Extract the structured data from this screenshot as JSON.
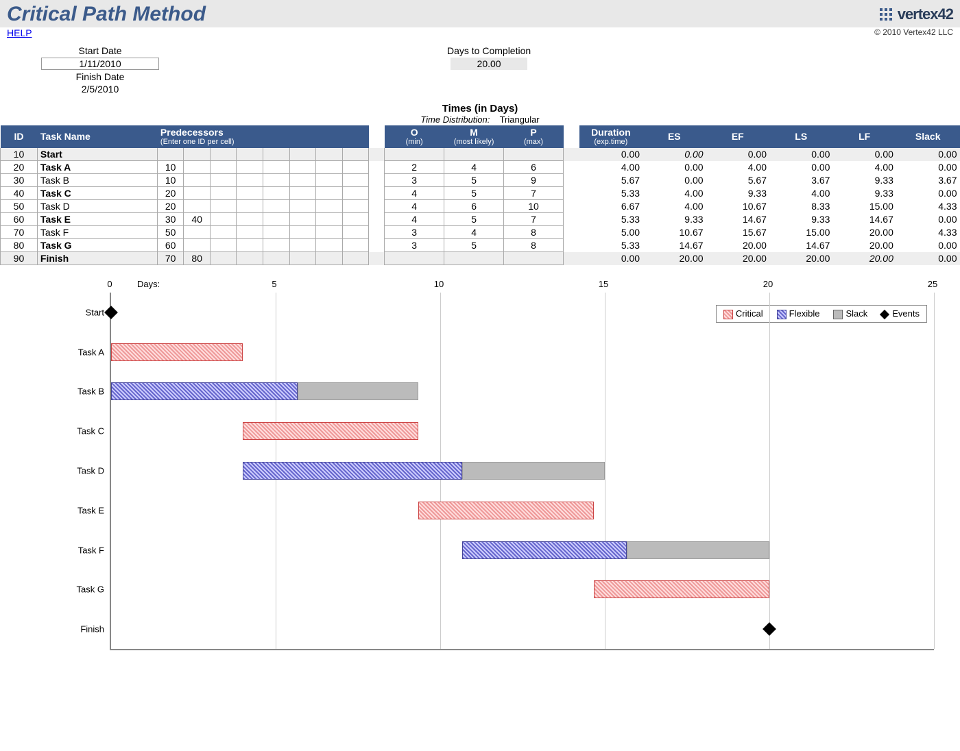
{
  "header": {
    "title": "Critical Path Method",
    "help_link": "HELP",
    "brand": "vertex42",
    "copyright": "© 2010 Vertex42 LLC"
  },
  "summary": {
    "start_date_label": "Start Date",
    "start_date_value": "1/11/2010",
    "finish_date_label": "Finish Date",
    "finish_date_value": "2/5/2010",
    "days_to_completion_label": "Days to Completion",
    "days_to_completion_value": "20.00"
  },
  "table_headers": {
    "times_heading": "Times (in Days)",
    "time_distribution_label": "Time Distribution:",
    "time_distribution_value": "Triangular",
    "id": "ID",
    "task_name": "Task Name",
    "predecessors": "Predecessors",
    "predecessors_sub": "(Enter one ID per cell)",
    "o": "O",
    "o_sub": "(min)",
    "m": "M",
    "m_sub": "(most likely)",
    "p": "P",
    "p_sub": "(max)",
    "duration": "Duration",
    "duration_sub": "(exp.time)",
    "es": "ES",
    "ef": "EF",
    "ls": "LS",
    "lf": "LF",
    "slack": "Slack"
  },
  "tasks": [
    {
      "id": "10",
      "name": "Start",
      "bold": true,
      "shade": true,
      "pred": [
        "",
        "",
        "",
        "",
        "",
        "",
        "",
        ""
      ],
      "o": "",
      "m": "",
      "p": "",
      "dur": "0.00",
      "es": "0.00",
      "es_italic": true,
      "ef": "0.00",
      "ls": "0.00",
      "lf": "0.00",
      "slack": "0.00"
    },
    {
      "id": "20",
      "name": "Task A",
      "bold": true,
      "shade": false,
      "pred": [
        "10",
        "",
        "",
        "",
        "",
        "",
        "",
        ""
      ],
      "o": "2",
      "m": "4",
      "p": "6",
      "dur": "4.00",
      "es": "0.00",
      "ef": "4.00",
      "ls": "0.00",
      "lf": "4.00",
      "slack": "0.00"
    },
    {
      "id": "30",
      "name": "Task B",
      "bold": false,
      "shade": false,
      "pred": [
        "10",
        "",
        "",
        "",
        "",
        "",
        "",
        ""
      ],
      "o": "3",
      "m": "5",
      "p": "9",
      "dur": "5.67",
      "es": "0.00",
      "ef": "5.67",
      "ls": "3.67",
      "lf": "9.33",
      "slack": "3.67"
    },
    {
      "id": "40",
      "name": "Task C",
      "bold": true,
      "shade": false,
      "pred": [
        "20",
        "",
        "",
        "",
        "",
        "",
        "",
        ""
      ],
      "o": "4",
      "m": "5",
      "p": "7",
      "dur": "5.33",
      "es": "4.00",
      "ef": "9.33",
      "ls": "4.00",
      "lf": "9.33",
      "slack": "0.00"
    },
    {
      "id": "50",
      "name": "Task D",
      "bold": false,
      "shade": false,
      "pred": [
        "20",
        "",
        "",
        "",
        "",
        "",
        "",
        ""
      ],
      "o": "4",
      "m": "6",
      "p": "10",
      "dur": "6.67",
      "es": "4.00",
      "ef": "10.67",
      "ls": "8.33",
      "lf": "15.00",
      "slack": "4.33"
    },
    {
      "id": "60",
      "name": "Task E",
      "bold": true,
      "shade": false,
      "pred": [
        "30",
        "40",
        "",
        "",
        "",
        "",
        "",
        ""
      ],
      "o": "4",
      "m": "5",
      "p": "7",
      "dur": "5.33",
      "es": "9.33",
      "ef": "14.67",
      "ls": "9.33",
      "lf": "14.67",
      "slack": "0.00"
    },
    {
      "id": "70",
      "name": "Task F",
      "bold": false,
      "shade": false,
      "pred": [
        "50",
        "",
        "",
        "",
        "",
        "",
        "",
        ""
      ],
      "o": "3",
      "m": "4",
      "p": "8",
      "dur": "5.00",
      "es": "10.67",
      "ef": "15.67",
      "ls": "15.00",
      "lf": "20.00",
      "slack": "4.33"
    },
    {
      "id": "80",
      "name": "Task G",
      "bold": true,
      "shade": false,
      "pred": [
        "60",
        "",
        "",
        "",
        "",
        "",
        "",
        ""
      ],
      "o": "3",
      "m": "5",
      "p": "8",
      "dur": "5.33",
      "es": "14.67",
      "ef": "20.00",
      "ls": "14.67",
      "lf": "20.00",
      "slack": "0.00"
    },
    {
      "id": "90",
      "name": "Finish",
      "bold": true,
      "shade": true,
      "pred": [
        "70",
        "80",
        "",
        "",
        "",
        "",
        "",
        ""
      ],
      "o": "",
      "m": "",
      "p": "",
      "dur": "0.00",
      "es": "20.00",
      "ef": "20.00",
      "ls": "20.00",
      "lf": "20.00",
      "lf_italic": true,
      "slack": "0.00"
    }
  ],
  "chart": {
    "days_label": "Days:",
    "legend": {
      "critical": "Critical",
      "flexible": "Flexible",
      "slack": "Slack",
      "events": "Events"
    }
  },
  "chart_data": {
    "type": "bar",
    "title": "",
    "xlabel": "Days",
    "ylabel": "",
    "xlim": [
      0,
      25
    ],
    "x_ticks": [
      0,
      5,
      10,
      15,
      20,
      25
    ],
    "categories": [
      "Start",
      "Task A",
      "Task B",
      "Task C",
      "Task D",
      "Task E",
      "Task F",
      "Task G",
      "Finish"
    ],
    "series": [
      {
        "name": "Critical",
        "color": "#e07070",
        "bars": [
          {
            "category": "Task A",
            "start": 0.0,
            "end": 4.0
          },
          {
            "category": "Task C",
            "start": 4.0,
            "end": 9.33
          },
          {
            "category": "Task E",
            "start": 9.33,
            "end": 14.67
          },
          {
            "category": "Task G",
            "start": 14.67,
            "end": 20.0
          }
        ]
      },
      {
        "name": "Flexible",
        "color": "#6070c0",
        "bars": [
          {
            "category": "Task B",
            "start": 0.0,
            "end": 5.67
          },
          {
            "category": "Task D",
            "start": 4.0,
            "end": 10.67
          },
          {
            "category": "Task F",
            "start": 10.67,
            "end": 15.67
          }
        ]
      },
      {
        "name": "Slack",
        "color": "#bbbbbb",
        "bars": [
          {
            "category": "Task B",
            "start": 5.67,
            "end": 9.33
          },
          {
            "category": "Task D",
            "start": 10.67,
            "end": 15.0
          },
          {
            "category": "Task F",
            "start": 15.67,
            "end": 20.0
          }
        ]
      },
      {
        "name": "Events",
        "type": "marker",
        "points": [
          {
            "category": "Start",
            "x": 0.0
          },
          {
            "category": "Finish",
            "x": 20.0
          }
        ]
      }
    ]
  }
}
